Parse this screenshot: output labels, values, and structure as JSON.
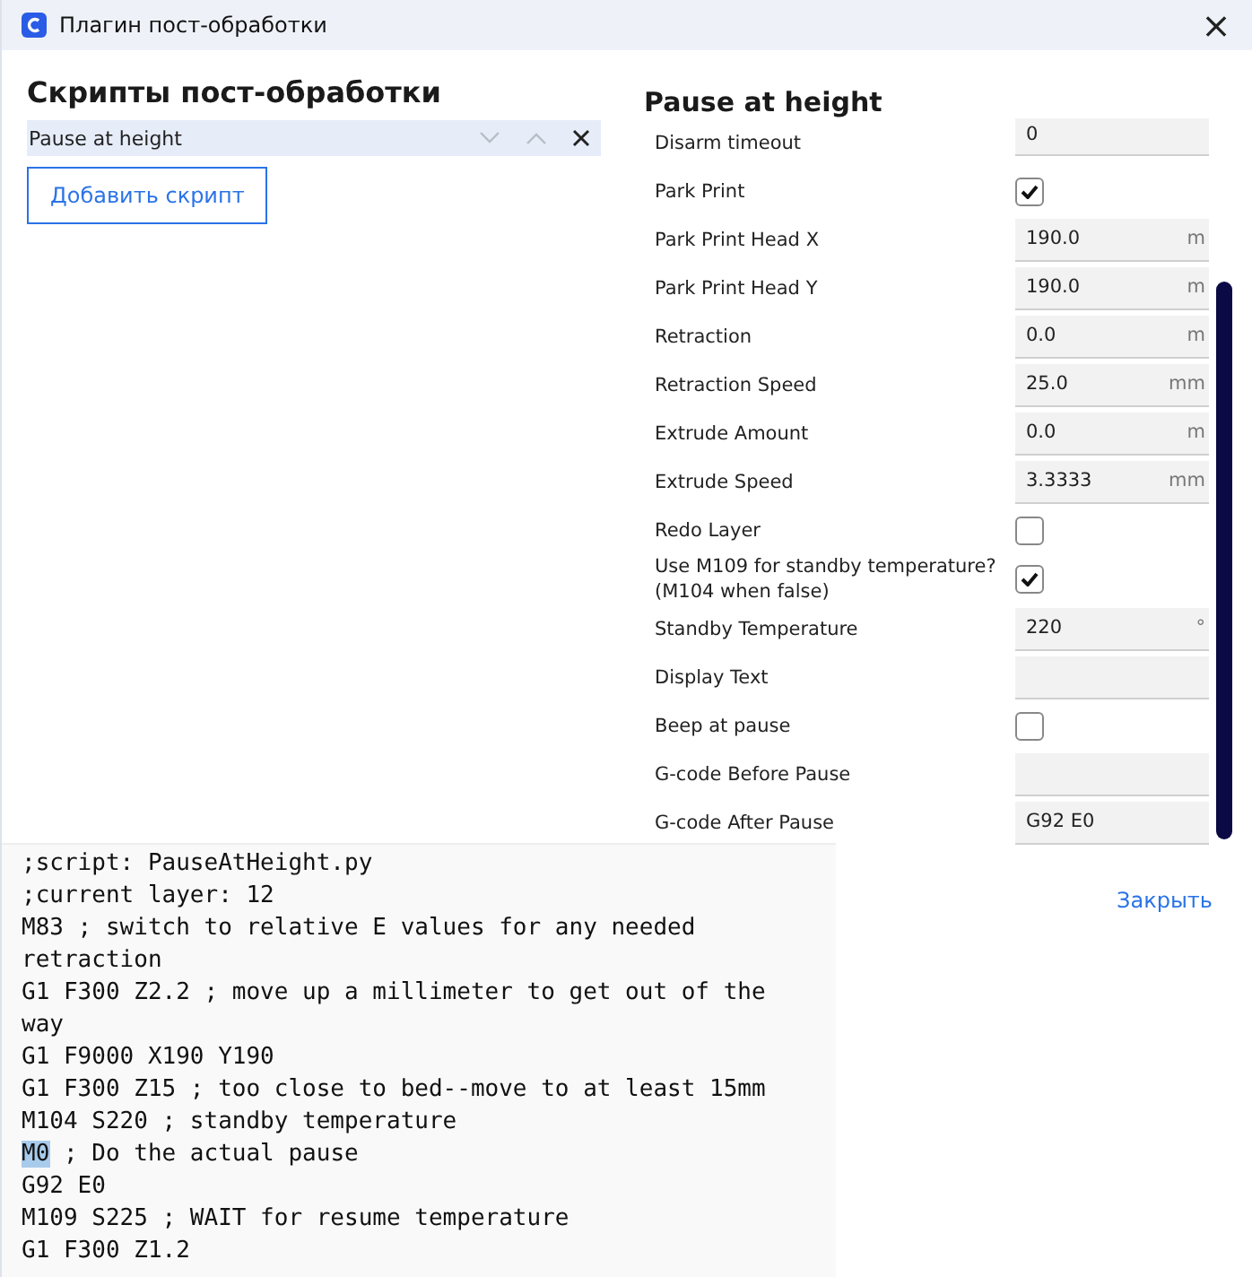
{
  "window": {
    "title": "Плагин пост-обработки",
    "close": "×"
  },
  "scripts": {
    "heading": "Скрипты пост-обработки",
    "items": [
      {
        "label": "Pause at height",
        "selected": true
      }
    ],
    "add_button": "Добавить скрипт"
  },
  "settings": {
    "heading": "Pause at height",
    "rows": [
      {
        "kind": "text",
        "label": "Disarm timeout",
        "value": "0"
      },
      {
        "kind": "checkbox",
        "label": "Park Print",
        "checked": true
      },
      {
        "kind": "text",
        "label": "Park Print Head X",
        "value": "190.0",
        "unit": "m"
      },
      {
        "kind": "text",
        "label": "Park Print Head Y",
        "value": "190.0",
        "unit": "m"
      },
      {
        "kind": "text",
        "label": "Retraction",
        "value": "0.0",
        "unit": "m"
      },
      {
        "kind": "text",
        "label": "Retraction Speed",
        "value": "25.0",
        "unit": "mm"
      },
      {
        "kind": "text",
        "label": "Extrude Amount",
        "value": "0.0",
        "unit": "m"
      },
      {
        "kind": "text",
        "label": "Extrude Speed",
        "value": "3.3333",
        "unit": "mm"
      },
      {
        "kind": "checkbox",
        "label": "Redo Layer",
        "checked": false
      },
      {
        "kind": "checkbox",
        "label": "Use M109 for standby temperature? (M104 when false)",
        "checked": true
      },
      {
        "kind": "text",
        "label": "Standby Temperature",
        "value": "220",
        "unit": "°"
      },
      {
        "kind": "text",
        "label": "Display Text"
      },
      {
        "kind": "checkbox",
        "label": "Beep at pause",
        "checked": false
      },
      {
        "kind": "text",
        "label": "G-code Before Pause"
      },
      {
        "kind": "text",
        "label": "G-code After Pause",
        "value": "G92 E0"
      }
    ]
  },
  "close_button": "Закрыть",
  "gcode_preview": {
    "lines": [
      {
        "text": ";script: PauseAtHeight.py"
      },
      {
        "text": ";current layer: 12"
      },
      {
        "text": "M83 ; switch to relative E values for any needed retraction"
      },
      {
        "text": "G1 F300 Z2.2 ; move up a millimeter to get out of the way"
      },
      {
        "text": "G1 F9000 X190 Y190"
      },
      {
        "text": "G1 F300 Z15 ; too close to bed--move to at least 15mm"
      },
      {
        "text": "M104 S220 ; standby temperature"
      },
      {
        "highlight": "M0",
        "text": " ; Do the actual pause"
      },
      {
        "text": "G92 E0"
      },
      {
        "text": "M109 S225 ; WAIT for resume temperature"
      },
      {
        "text": "G1 F300 Z1.2"
      }
    ]
  }
}
